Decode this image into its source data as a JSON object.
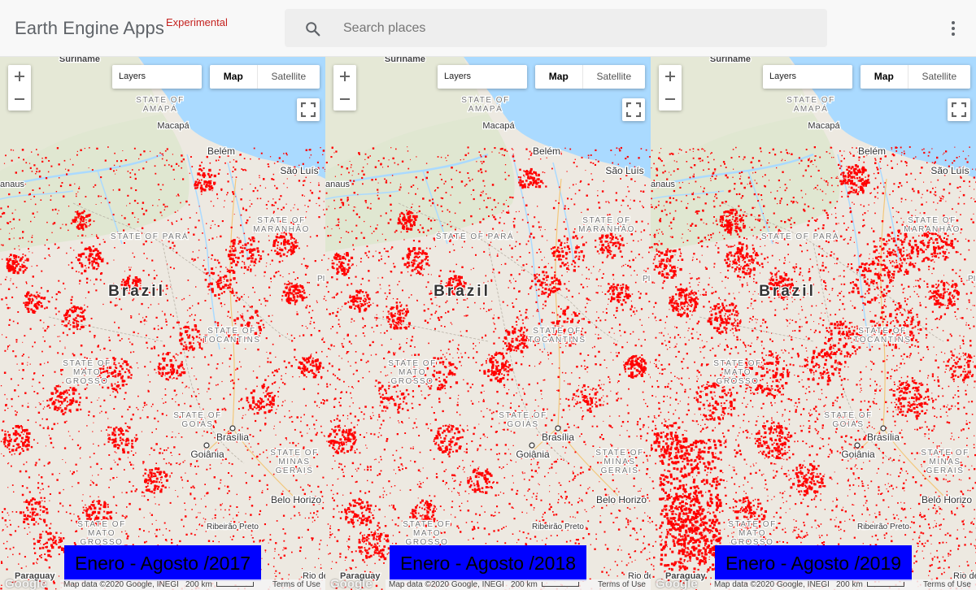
{
  "header": {
    "app_name": "Earth Engine Apps",
    "badge": "Experimental",
    "search_placeholder": "Search places"
  },
  "maps": [
    {
      "period": "Enero - Agosto /2017"
    },
    {
      "period": "Enero - Agosto /2018"
    },
    {
      "period": "Enero - Agosto /2019"
    }
  ],
  "map_controls": {
    "layers": "Layers",
    "map_type_map": "Map",
    "map_type_satellite": "Satellite",
    "zoom_in": "+",
    "zoom_out": "−"
  },
  "map_labels": {
    "suriname": "Suriname",
    "amapa": "STATE OF AMAPÁ",
    "macapa": "Macapá",
    "belem": "Belém",
    "sao_luis": "São Luís",
    "manaus": "anaus",
    "maranhao": "STATE OF MARANHÃO",
    "para": "STATE OF PARÁ",
    "brazil": "Brazil",
    "tocantins": "STATE OF TOCANTINS",
    "mato_grosso": "STATE OF MATO GROSSO",
    "goias": "STATE OF GOIÁS",
    "brasilia": "Brasília",
    "goiania": "Goiânia",
    "minas": "STATE OF MINAS GERAIS",
    "belo_horizonte": "Belo Horizo",
    "ribeirao": "Ribeirão Preto",
    "mato_grosso_sul": "STATE OF MATO GROSSO",
    "paraguay": "Paraguay",
    "rio": "Rio de",
    "pi": "PI"
  },
  "attribution": {
    "google": "Google",
    "map_data": "Map data ©2020 Google, INEGI",
    "scale": "200 km",
    "terms": "Terms of Use"
  },
  "colors": {
    "land": "#ede9e1",
    "water": "#aadaff",
    "forest": "#c8e0b8",
    "deforestation": "#ff0000",
    "period_box": "#0000ff"
  }
}
